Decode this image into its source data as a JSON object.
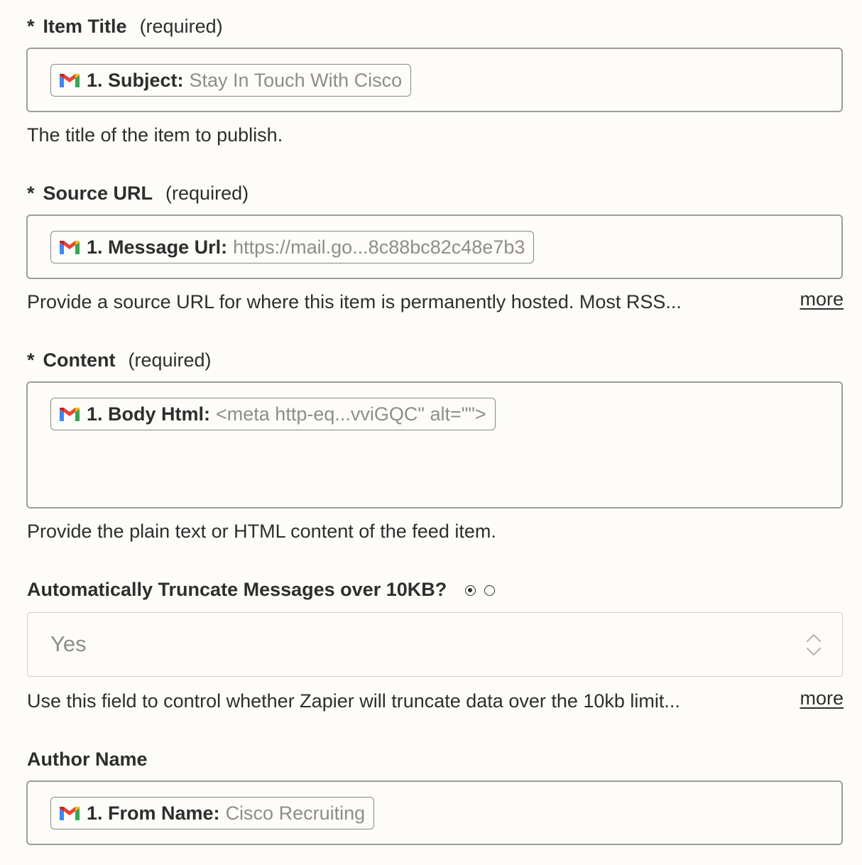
{
  "fields": {
    "item_title": {
      "label": "Item Title",
      "required": "(required)",
      "pill_key": "1. Subject:",
      "pill_value": "Stay In Touch With Cisco",
      "help": "The title of the item to publish."
    },
    "source_url": {
      "label": "Source URL",
      "required": "(required)",
      "pill_key": "1. Message Url:",
      "pill_value": "https://mail.go...8c88bc82c48e7b3",
      "help": "Provide a source URL for where this item is permanently hosted. Most RSS...",
      "more": "more"
    },
    "content": {
      "label": "Content",
      "required": "(required)",
      "pill_key": "1. Body Html:",
      "pill_value": "<meta http-eq...vviGQC\" alt=\"\">",
      "help": "Provide the plain text or HTML content of the feed item."
    },
    "truncate": {
      "label": "Automatically Truncate Messages over 10KB?",
      "selected": "Yes",
      "help": "Use this field to control whether Zapier will truncate data over the 10kb limit...",
      "more": "more"
    },
    "author_name": {
      "label": "Author Name",
      "pill_key": "1. From Name:",
      "pill_value": "Cisco Recruiting"
    }
  },
  "required_marker": "*",
  "icons": {
    "pill_icon": "gmail-icon",
    "select_icon": "chevron-up-down-icon"
  },
  "colors": {
    "background": "#fdfcf8",
    "text": "#2d2e2e",
    "muted": "#8e8d8a",
    "gmail_red": "#ea4335",
    "gmail_blue": "#4285f4",
    "gmail_green": "#34a853",
    "gmail_yellow": "#fbbc04"
  }
}
